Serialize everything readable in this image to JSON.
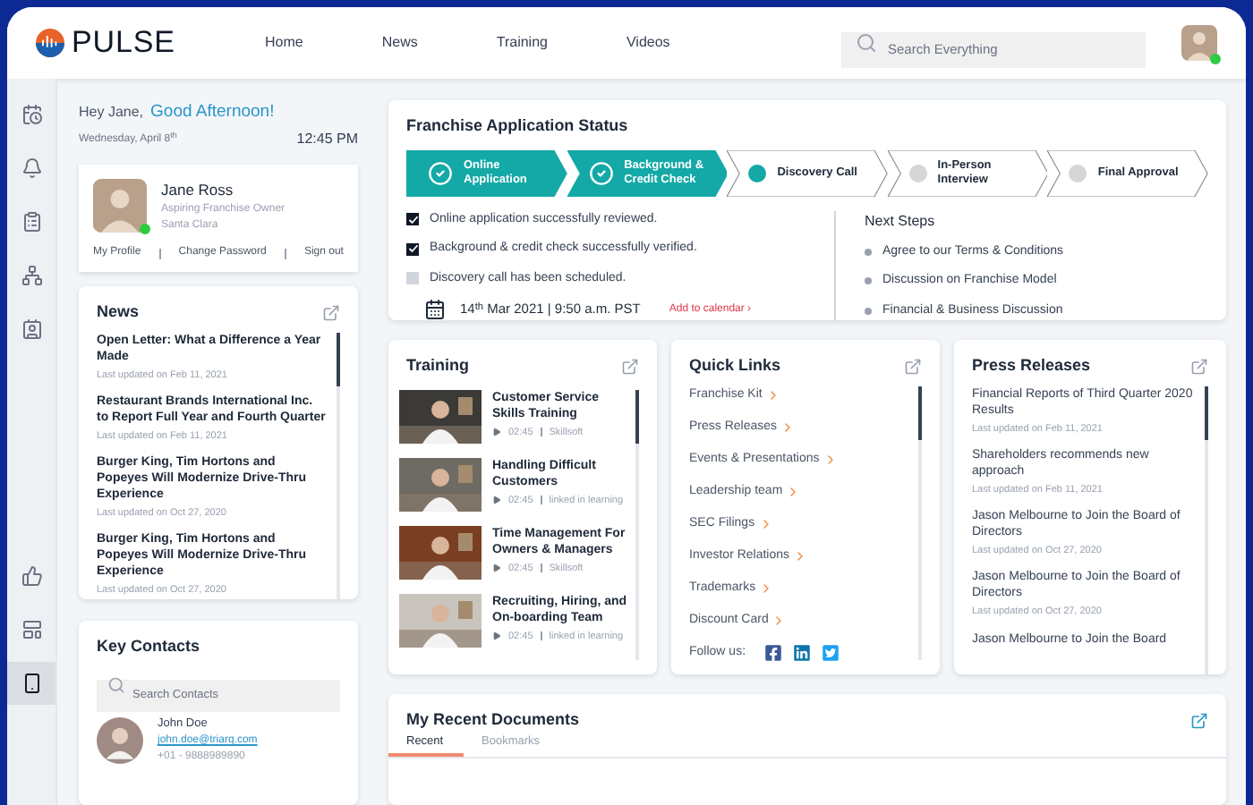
{
  "header": {
    "logo": "PULSE",
    "nav": [
      "Home",
      "News",
      "Training",
      "Videos"
    ],
    "search": {
      "placeholder": "Search Everything"
    }
  },
  "sidebar": {
    "items": [
      {
        "selected": false
      },
      {
        "selected": false
      },
      {
        "selected": false
      },
      {
        "selected": false
      },
      {
        "selected": false
      },
      {
        "selected": false
      },
      {
        "selected": false
      },
      {
        "selected": true
      }
    ]
  },
  "greeting": {
    "hello": "Hey Jane,",
    "salutation": "Good Afternoon!",
    "date": "Wednesday, April 8$^{th}$",
    "time": "12:45 PM"
  },
  "profile": {
    "name": "Jane Ross",
    "role": "Aspiring Franchise Owner",
    "location": "Santa Clara",
    "online": true,
    "links": [
      "My Profile",
      "Change Password",
      "Sign out"
    ]
  },
  "news": {
    "title": "News",
    "items": [
      {
        "headline": "Open Letter: What a Difference a Year Made",
        "updated": "Last updated on Feb 11, 2021"
      },
      {
        "headline": "Restaurant Brands International Inc. to Report Full Year and Fourth Quarter",
        "updated": "Last updated on Feb 11, 2021"
      },
      {
        "headline": "Burger King, Tim Hortons and Popeyes Will Modernize Drive-Thru Experience",
        "updated": "Last updated on Oct 27, 2020"
      },
      {
        "headline": "Burger King, Tim Hortons and Popeyes Will Modernize Drive-Thru Experience",
        "updated": "Last updated on Oct 27, 2020"
      }
    ]
  },
  "key_contacts": {
    "title": "Key Contacts",
    "search": {
      "placeholder": "Search Contacts"
    },
    "contacts": [
      {
        "name": "John Doe",
        "email": "john.doe@triarq.com",
        "phone": "+01 - 9888989890"
      }
    ]
  },
  "application_status": {
    "title": "Franchise Application Status",
    "steps": [
      {
        "label": "Online Application",
        "kind": "done"
      },
      {
        "label": "Background & Credit Check",
        "kind": "done"
      },
      {
        "label": "Discovery Call",
        "kind": "current"
      },
      {
        "label": "In-Person Interview",
        "kind": "pending"
      },
      {
        "label": "Final Approval",
        "kind": "pending"
      }
    ],
    "checklist": [
      {
        "text": "Online application successfully reviewed.",
        "checked": true
      },
      {
        "text": "Background & credit check successfully verified.",
        "checked": true
      },
      {
        "text": "Discovery call has been scheduled.",
        "checked": false
      }
    ],
    "appointment": {
      "date": "14$^{th}$ Mar 2021 | 9:50 a.m. PST",
      "action": "Add to calendar ›"
    },
    "next_steps": {
      "title": "Next Steps",
      "items": [
        "Agree to our Terms & Conditions",
        "Discussion on Franchise Model",
        "Financial & Business Discussion"
      ]
    }
  },
  "training": {
    "title": "Training",
    "items": [
      {
        "title": "Customer Service Skills Training",
        "duration": "02:45",
        "provider": "Skillsoft",
        "kind": "picture"
      },
      {
        "title": "Handling Difficult Customers",
        "duration": "02:45",
        "provider": "linked in learning",
        "kind": "picture"
      },
      {
        "title": "Time Management For Owners & Managers",
        "duration": "02:45",
        "provider": "Skillsoft",
        "kind": "picture"
      },
      {
        "title": "Recruiting, Hiring, and On-boarding Team",
        "duration": "02:45",
        "provider": "linked in learning",
        "kind": "picture"
      }
    ]
  },
  "quick_links": {
    "title": "Quick Links",
    "links": [
      "Franchise Kit",
      "Press Releases",
      "Events & Presentations",
      "Leadership team",
      "SEC Filings",
      "Investor Relations",
      "Trademarks",
      "Discount Card"
    ],
    "follow_label": "Follow us:"
  },
  "press_releases": {
    "title": "Press Releases",
    "items": [
      {
        "headline": "Financial Reports of Third Quarter 2020 Results",
        "updated": "Last updated on Feb 11, 2021"
      },
      {
        "headline": "Shareholders recommends new approach",
        "updated": "Last updated on Feb 11, 2021"
      },
      {
        "headline": "Jason Melbourne to Join the Board of Directors",
        "updated": "Last updated on Oct 27, 2020"
      },
      {
        "headline": "Jason Melbourne to Join the Board of Directors",
        "updated": "Last updated on Oct 27, 2020"
      },
      {
        "headline": "Jason Melbourne to Join the Board"
      }
    ]
  },
  "recent_documents": {
    "title": "My Recent Documents",
    "tabs": [
      {
        "label": "Recent",
        "selected": true
      },
      {
        "label": "Bookmarks",
        "selected": false
      }
    ]
  }
}
